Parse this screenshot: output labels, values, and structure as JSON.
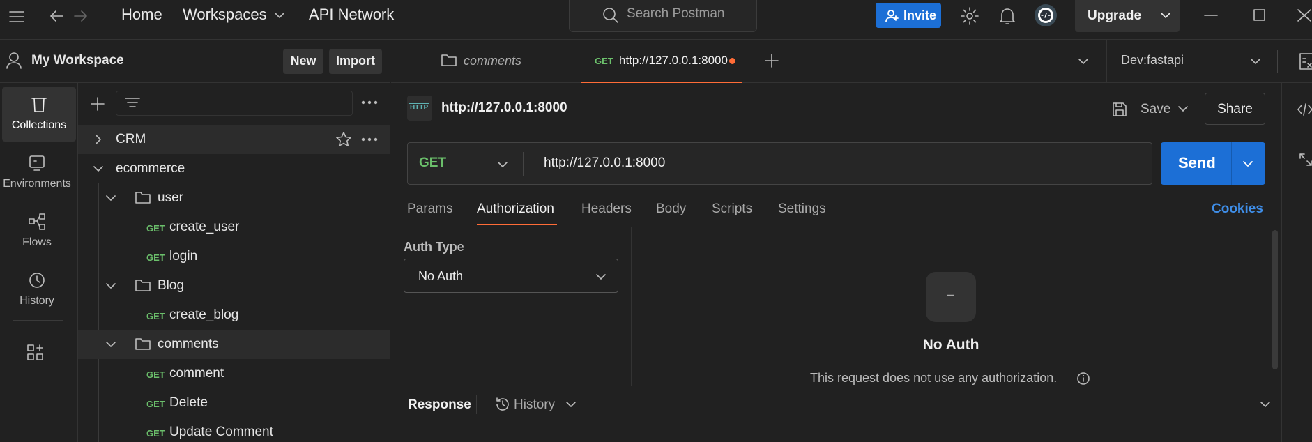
{
  "topbar": {
    "nav_home": "Home",
    "nav_workspaces": "Workspaces",
    "nav_api_network": "API Network",
    "search_placeholder": "Search Postman",
    "invite_label": "Invite",
    "upgrade_label": "Upgrade"
  },
  "workspace": {
    "name": "My Workspace",
    "new_label": "New",
    "import_label": "Import"
  },
  "rail": {
    "items": [
      {
        "label": "Collections",
        "icon": "collections-icon"
      },
      {
        "label": "Environments",
        "icon": "environments-icon"
      },
      {
        "label": "Flows",
        "icon": "flows-icon"
      },
      {
        "label": "History",
        "icon": "history-icon"
      }
    ]
  },
  "tree": {
    "collection_crm": "CRM",
    "collection_ecommerce": "ecommerce",
    "folder_user": "user",
    "folder_blog": "Blog",
    "folder_comments": "comments",
    "requests": [
      {
        "method": "GET",
        "name": "create_user"
      },
      {
        "method": "GET",
        "name": "login"
      },
      {
        "method": "GET",
        "name": "create_blog"
      },
      {
        "method": "GET",
        "name": "comment"
      },
      {
        "method": "GET",
        "name": "Delete"
      },
      {
        "method": "GET",
        "name": "Update Comment"
      }
    ]
  },
  "tabs": {
    "tab1_label": "comments",
    "tab2_method": "GET",
    "tab2_label": "http://127.0.0.1:8000",
    "environment": "Dev:fastapi"
  },
  "request": {
    "title": "http://127.0.0.1:8000",
    "http_badge": "HTTP",
    "save_label": "Save",
    "share_label": "Share",
    "method": "GET",
    "url": "http://127.0.0.1:8000",
    "send_label": "Send"
  },
  "subtabs": {
    "params": "Params",
    "authorization": "Authorization",
    "headers": "Headers",
    "body": "Body",
    "scripts": "Scripts",
    "settings": "Settings",
    "cookies": "Cookies"
  },
  "auth": {
    "type_label": "Auth Type",
    "type_value": "No Auth",
    "placeholder_glyph": "–",
    "title": "No Auth",
    "description": "This request does not use any authorization."
  },
  "response": {
    "label": "Response",
    "history_label": "History"
  },
  "colors": {
    "accent_orange": "#ff6c37",
    "primary_blue": "#1c6fd6",
    "get_green": "#6bbf6b",
    "link_blue": "#3f8ee8"
  }
}
